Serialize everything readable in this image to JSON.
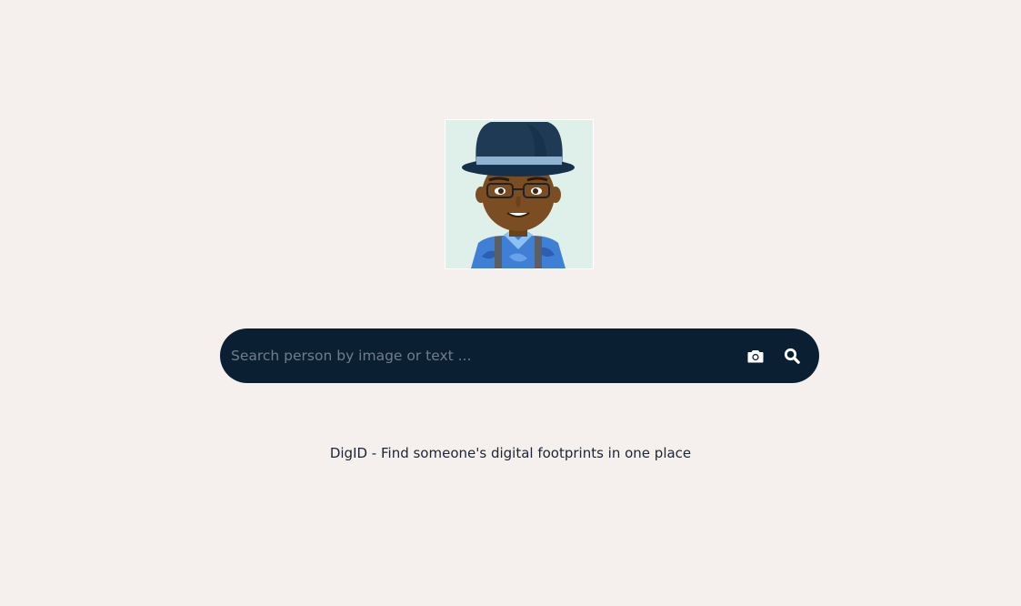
{
  "logo": {
    "icon": "avatar-icon",
    "colors": {
      "background": "#dff0ea",
      "hat": "#1e3a55",
      "hat_band": "#8fb3d0",
      "skin": "#7a4e22",
      "shirt": "#3f7fd6"
    }
  },
  "search": {
    "placeholder": "Search person by image or text ...",
    "value": "",
    "camera_icon": "camera-icon",
    "search_icon": "search-icon",
    "bar_color": "#0b1f33"
  },
  "tagline": {
    "text": "DigID - Find someone's digital footprints in one place"
  },
  "theme": {
    "page_background": "#f5f0ee",
    "text_color": "#1d2433"
  }
}
